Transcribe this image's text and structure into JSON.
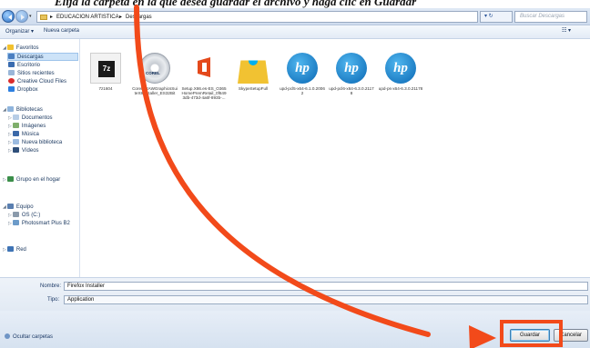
{
  "caption": {
    "text": "Elija la carpeta en la que desea guardar el archivo y haga clic en Guardar"
  },
  "address": {
    "crumbs": [
      "EDUCACION ARTISTICA",
      "Descargas"
    ],
    "separator": "▸",
    "refresh": "▾ ↻",
    "search_placeholder": "Buscar Descargas"
  },
  "toolbar": {
    "organize": "Organizar ▾",
    "new_folder": "Nueva carpeta",
    "views": "☷ ▾"
  },
  "sidebar": {
    "favorites": "Favoritos",
    "fav_items": [
      "Descargas",
      "Escritorio",
      "Sitios recientes",
      "Creative Cloud Files",
      "Dropbox"
    ],
    "libraries": "Bibliotecas",
    "lib_items": [
      "Documentos",
      "Imágenes",
      "Música",
      "Nueva biblioteca",
      "Vídeos"
    ],
    "homegroup": "Grupo en el hogar",
    "computer": "Equipo",
    "comp_items": [
      "OS (C:)",
      "Photosmart Plus B2"
    ],
    "network": "Red"
  },
  "files": [
    {
      "name": "7z1604",
      "icon": "7zip-icon"
    },
    {
      "name": "CorelDRAWGraphicsSuiteX8Installer_ES32Bit",
      "icon": "corel-cd-icon"
    },
    {
      "name": "Setup.X86.es-ES_O365HomePremRetail_0f6493db-473d-4a6f-893b-...",
      "icon": "office-icon"
    },
    {
      "name": "SkypeSetupFull",
      "icon": "skype-setup-icon"
    },
    {
      "name": "upd-pcl5-x64-6.1.0.20062",
      "icon": "hp-icon"
    },
    {
      "name": "upd-pcl6-x64-6.3.0.21178",
      "icon": "hp-icon"
    },
    {
      "name": "upd-ps-x64-6.3.0.21178",
      "icon": "hp-icon"
    }
  ],
  "form": {
    "name_label": "Nombre:",
    "name_value": "Firefox Installer",
    "type_label": "Tipo:",
    "type_value": "Application"
  },
  "footer": {
    "hide_folders": "Ocultar carpetas",
    "save": "Guardar",
    "cancel": "Cancelar"
  },
  "colors": {
    "highlight": "#f24a1a",
    "selection": "#cde3f8"
  }
}
